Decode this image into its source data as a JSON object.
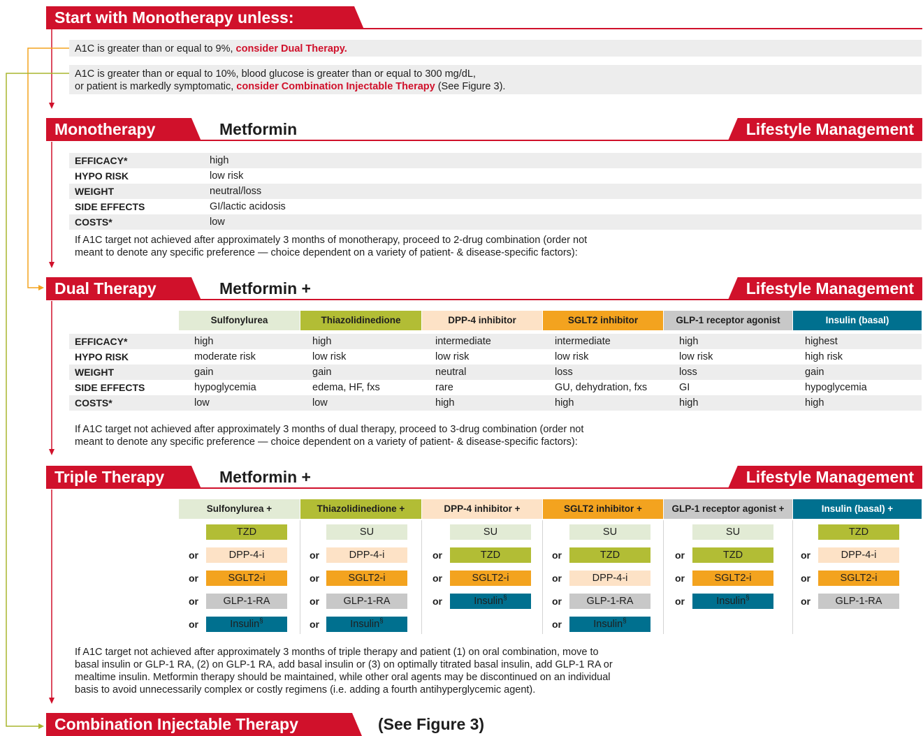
{
  "start_header": "Start with Monotherapy unless:",
  "conditions": {
    "dual_line1_prefix": "A1C is greater than or equal to 9%, ",
    "dual_line1_link": "consider Dual Therapy.",
    "combo_line1": "A1C is greater than or equal to 10%, blood glucose is greater than or equal to 300 mg/dL,",
    "combo_line2_prefix": "or patient is markedly symptomatic, ",
    "combo_line2_link": "consider Combination Injectable Therapy",
    "combo_line2_suffix": " (See Figure 3)."
  },
  "mono": {
    "title": "Monotherapy",
    "drug": "Metformin",
    "lifestyle": "Lifestyle Management",
    "rows": [
      {
        "label": "EFFICACY*",
        "value": "high"
      },
      {
        "label": "HYPO RISK",
        "value": "low risk"
      },
      {
        "label": "WEIGHT",
        "value": "neutral/loss"
      },
      {
        "label": "SIDE EFFECTS",
        "value": "GI/lactic acidosis"
      },
      {
        "label": "COSTS*",
        "value": "low"
      }
    ],
    "note_line1": "If A1C target not achieved after approximately 3 months of monotherapy, proceed to 2-drug combination (order not",
    "note_line2": "meant to denote any specific preference — choice dependent on a variety of patient- & disease-specific factors):"
  },
  "dual": {
    "title": "Dual Therapy",
    "drug": "Metformin +",
    "lifestyle": "Lifestyle Management",
    "columns": [
      "Sulfonylurea",
      "Thiazolidinedione",
      "DPP-4 inhibitor",
      "SGLT2 inhibitor",
      "GLP-1 receptor agonist",
      "Insulin (basal)"
    ],
    "rows": [
      {
        "label": "EFFICACY*",
        "values": [
          "high",
          "high",
          "intermediate",
          "intermediate",
          "high",
          "highest"
        ]
      },
      {
        "label": "HYPO RISK",
        "values": [
          "moderate risk",
          "low risk",
          "low risk",
          "low risk",
          "low risk",
          "high risk"
        ]
      },
      {
        "label": "WEIGHT",
        "values": [
          "gain",
          "gain",
          "neutral",
          "loss",
          "loss",
          "gain"
        ]
      },
      {
        "label": "SIDE EFFECTS",
        "values": [
          "hypoglycemia",
          "edema, HF, fxs",
          "rare",
          "GU, dehydration, fxs",
          "GI",
          "hypoglycemia"
        ]
      },
      {
        "label": "COSTS*",
        "values": [
          "low",
          "low",
          "high",
          "high",
          "high",
          "high"
        ]
      }
    ],
    "note_line1": "If A1C target not achieved after approximately 3 months of dual therapy, proceed to 3-drug combination (order not",
    "note_line2": "meant to denote any specific preference — choice dependent on a variety of patient- & disease-specific factors):"
  },
  "triple": {
    "title": "Triple Therapy",
    "drug": "Metformin +",
    "lifestyle": "Lifestyle Management",
    "columns": [
      "Sulfonylurea +",
      "Thiazolidinedione +",
      "DPP-4 inhibitor +",
      "SGLT2 inhibitor +",
      "GLP-1 receptor agonist +",
      "Insulin (basal) +"
    ],
    "or_label": "or",
    "options": [
      [
        "TZD",
        "DPP-4-i",
        "SGLT2-i",
        "GLP-1-RA",
        "Insulin"
      ],
      [
        "SU",
        "DPP-4-i",
        "SGLT2-i",
        "GLP-1-RA",
        "Insulin"
      ],
      [
        "SU",
        "TZD",
        "SGLT2-i",
        "Insulin"
      ],
      [
        "SU",
        "TZD",
        "DPP-4-i",
        "GLP-1-RA",
        "Insulin"
      ],
      [
        "SU",
        "TZD",
        "SGLT2-i",
        "Insulin"
      ],
      [
        "TZD",
        "DPP-4-i",
        "SGLT2-i",
        "GLP-1-RA"
      ]
    ],
    "insulin_mark": "§",
    "note_lines": [
      "If A1C target not achieved after approximately 3 months of triple therapy and patient (1) on oral combination, move to",
      "basal insulin or GLP-1 RA, (2) on GLP-1 RA, add basal insulin or (3) on optimally titrated basal insulin, add GLP-1 RA or",
      "mealtime insulin. Metformin therapy should be maintained, while other oral agents may be discontinued on an individual",
      "basis to avoid unnecessarily complex or costly regimens (i.e. adding a fourth antihyperglycemic agent)."
    ]
  },
  "combo": {
    "title": "Combination Injectable Therapy",
    "see": "(See Figure 3)"
  },
  "colors": {
    "red": "#d0112b",
    "orange_arrow": "#f3a31f",
    "olive_arrow": "#a9b62e",
    "su": "#e2ebd5",
    "tzd": "#b2bd35",
    "dpp4": "#fde2c6",
    "sglt2": "#f3a31f",
    "glp1": "#c8c8c8",
    "insulin": "#00708f"
  }
}
